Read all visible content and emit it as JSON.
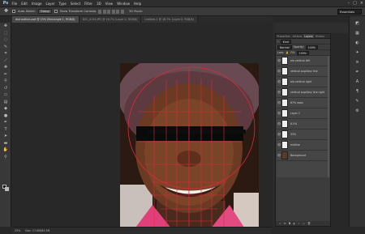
{
  "menu": {
    "logo": "Ps",
    "items": [
      "File",
      "Edit",
      "Image",
      "Layer",
      "Type",
      "Select",
      "Filter",
      "3D",
      "View",
      "Window",
      "Help"
    ]
  },
  "options": {
    "auto_select_label": "Auto-Select:",
    "auto_select_value": "Group",
    "transform_label": "Show Transform Controls",
    "mode_3d": "3D Mode:",
    "workspace": "Essentials"
  },
  "tabs": [
    "dsd outline.psd @ 25% (Rectangle 1, RGB/8)",
    "DSC_0194.JPG @ 16.7% (Layer 0, RGB/8)",
    "Untitled-1 @ 16.7% (Layer 0, RGB/8)"
  ],
  "status": {
    "zoom": "25%",
    "doc": "Doc: 17.0M/84.3M"
  },
  "layers_panel": {
    "tabs": [
      "Properties",
      "Actions",
      "Layers",
      "History"
    ],
    "kind_label": "Kind",
    "blend_mode": "Normal",
    "opacity_label": "Opacity:",
    "opacity": "100%",
    "lock_label": "Lock:",
    "fill_label": "Fill:",
    "fill": "100%",
    "layers": [
      {
        "name": "ala vertical left",
        "thumb": "light"
      },
      {
        "name": "vertical pupillary line",
        "thumb": "light"
      },
      {
        "name": "ala vertical right",
        "thumb": "light"
      },
      {
        "name": "vertical pupillary line right",
        "thumb": "light"
      },
      {
        "name": "67% rows",
        "thumb": "light"
      },
      {
        "name": "Layer 1",
        "thumb": "light"
      },
      {
        "name": "8.5%",
        "thumb": "light"
      },
      {
        "name": "33%",
        "thumb": "light"
      },
      {
        "name": "midline",
        "thumb": "light"
      },
      {
        "name": "Background",
        "thumb": "dark"
      }
    ]
  },
  "colors": {
    "guide_line": "#e0283c",
    "selected_layer": "#5d6f86"
  }
}
